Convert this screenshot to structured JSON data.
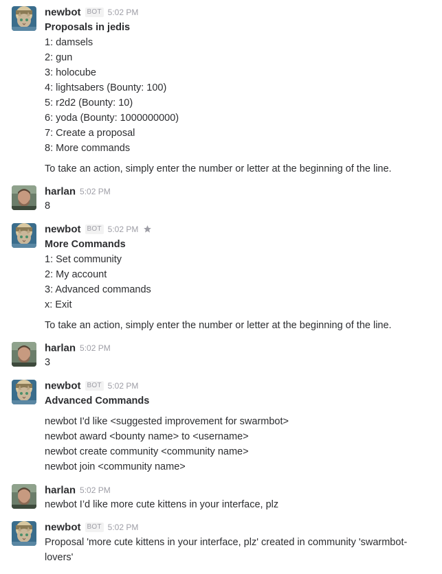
{
  "messages": [
    {
      "author": "newbot",
      "badge": "BOT",
      "time": "5:02 PM",
      "title": "Proposals in jedis",
      "items": [
        "1: damsels",
        "2: gun",
        "3: holocube",
        "4: lightsabers (Bounty: 100)",
        "5: r2d2 (Bounty: 10)",
        "6: yoda (Bounty: 1000000000)",
        "7: Create a proposal",
        "8: More commands"
      ],
      "footer": "To take an action, simply enter the number or letter at the beginning of the line."
    },
    {
      "author": "harlan",
      "time": "5:02 PM",
      "text": "8"
    },
    {
      "author": "newbot",
      "badge": "BOT",
      "time": "5:02 PM",
      "title": "More Commands",
      "items": [
        "1: Set community",
        "2: My account",
        "3: Advanced commands",
        "x: Exit"
      ],
      "footer": "To take an action, simply enter the number or letter at the beginning of the line."
    },
    {
      "author": "harlan",
      "time": "5:02 PM",
      "text": "3"
    },
    {
      "author": "newbot",
      "badge": "BOT",
      "time": "5:02 PM",
      "title": "Advanced Commands",
      "items": [
        "newbot I'd like <suggested improvement for swarmbot>",
        "newbot award <bounty name> to <username>",
        "newbot create community <community name>",
        "newbot join <community name>"
      ]
    },
    {
      "author": "harlan",
      "time": "5:02 PM",
      "text": "newbot I’d like more cute kittens in your interface, plz"
    },
    {
      "author": "newbot",
      "badge": "BOT",
      "time": "5:02 PM",
      "text": "Proposal 'more cute kittens in your interface, plz' created in community 'swarmbot-lovers'"
    }
  ],
  "colors": {
    "text": "#2c2d30",
    "muted": "#9e9ea6",
    "badge_bg": "#f2f2f2",
    "star": "#9e9ea6"
  },
  "icons": {
    "bot_avatar": "cat-astronaut-avatar",
    "user_avatar": "user-photo-avatar",
    "star": "star-icon"
  }
}
